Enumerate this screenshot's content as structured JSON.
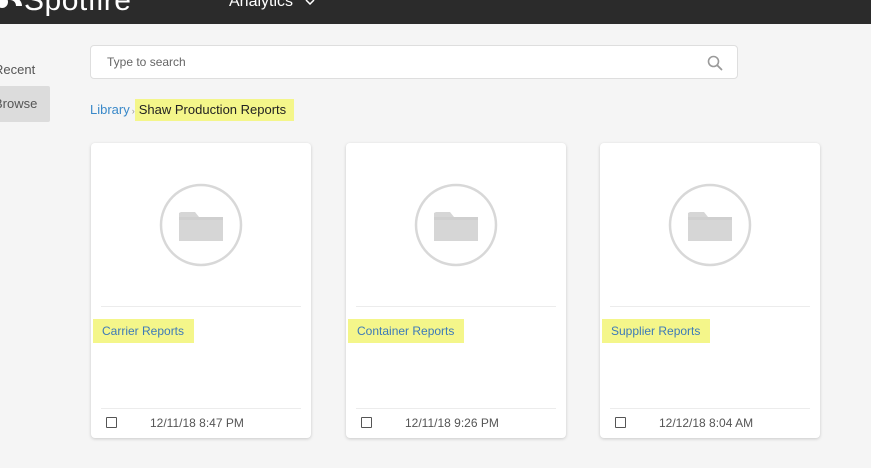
{
  "header": {
    "brand": "Spotfire",
    "brand_icon": "spotfire-logo-icon",
    "nav_label": "Analytics",
    "nav_icon": "chevron-down-icon"
  },
  "sidebar": {
    "items": [
      {
        "label": "Recent",
        "selected": false
      },
      {
        "label": "Browse",
        "selected": true
      }
    ]
  },
  "search": {
    "placeholder": "Type to search",
    "value": "",
    "icon": "search-icon"
  },
  "breadcrumb": {
    "root": "Library",
    "separator": "›",
    "current": "Shaw Production Reports"
  },
  "folders": [
    {
      "name": "Carrier Reports",
      "date": "12/11/18 8:47 PM",
      "icon": "folder-icon",
      "checked": false
    },
    {
      "name": "Container Reports",
      "date": "12/11/18 9:26 PM",
      "icon": "folder-icon",
      "checked": false
    },
    {
      "name": "Supplier Reports",
      "date": "12/12/18 8:04 AM",
      "icon": "folder-icon",
      "checked": false
    }
  ],
  "colors": {
    "topbar": "#2b2b2b",
    "highlight": "#f4f68a",
    "link": "#3a89c9"
  }
}
